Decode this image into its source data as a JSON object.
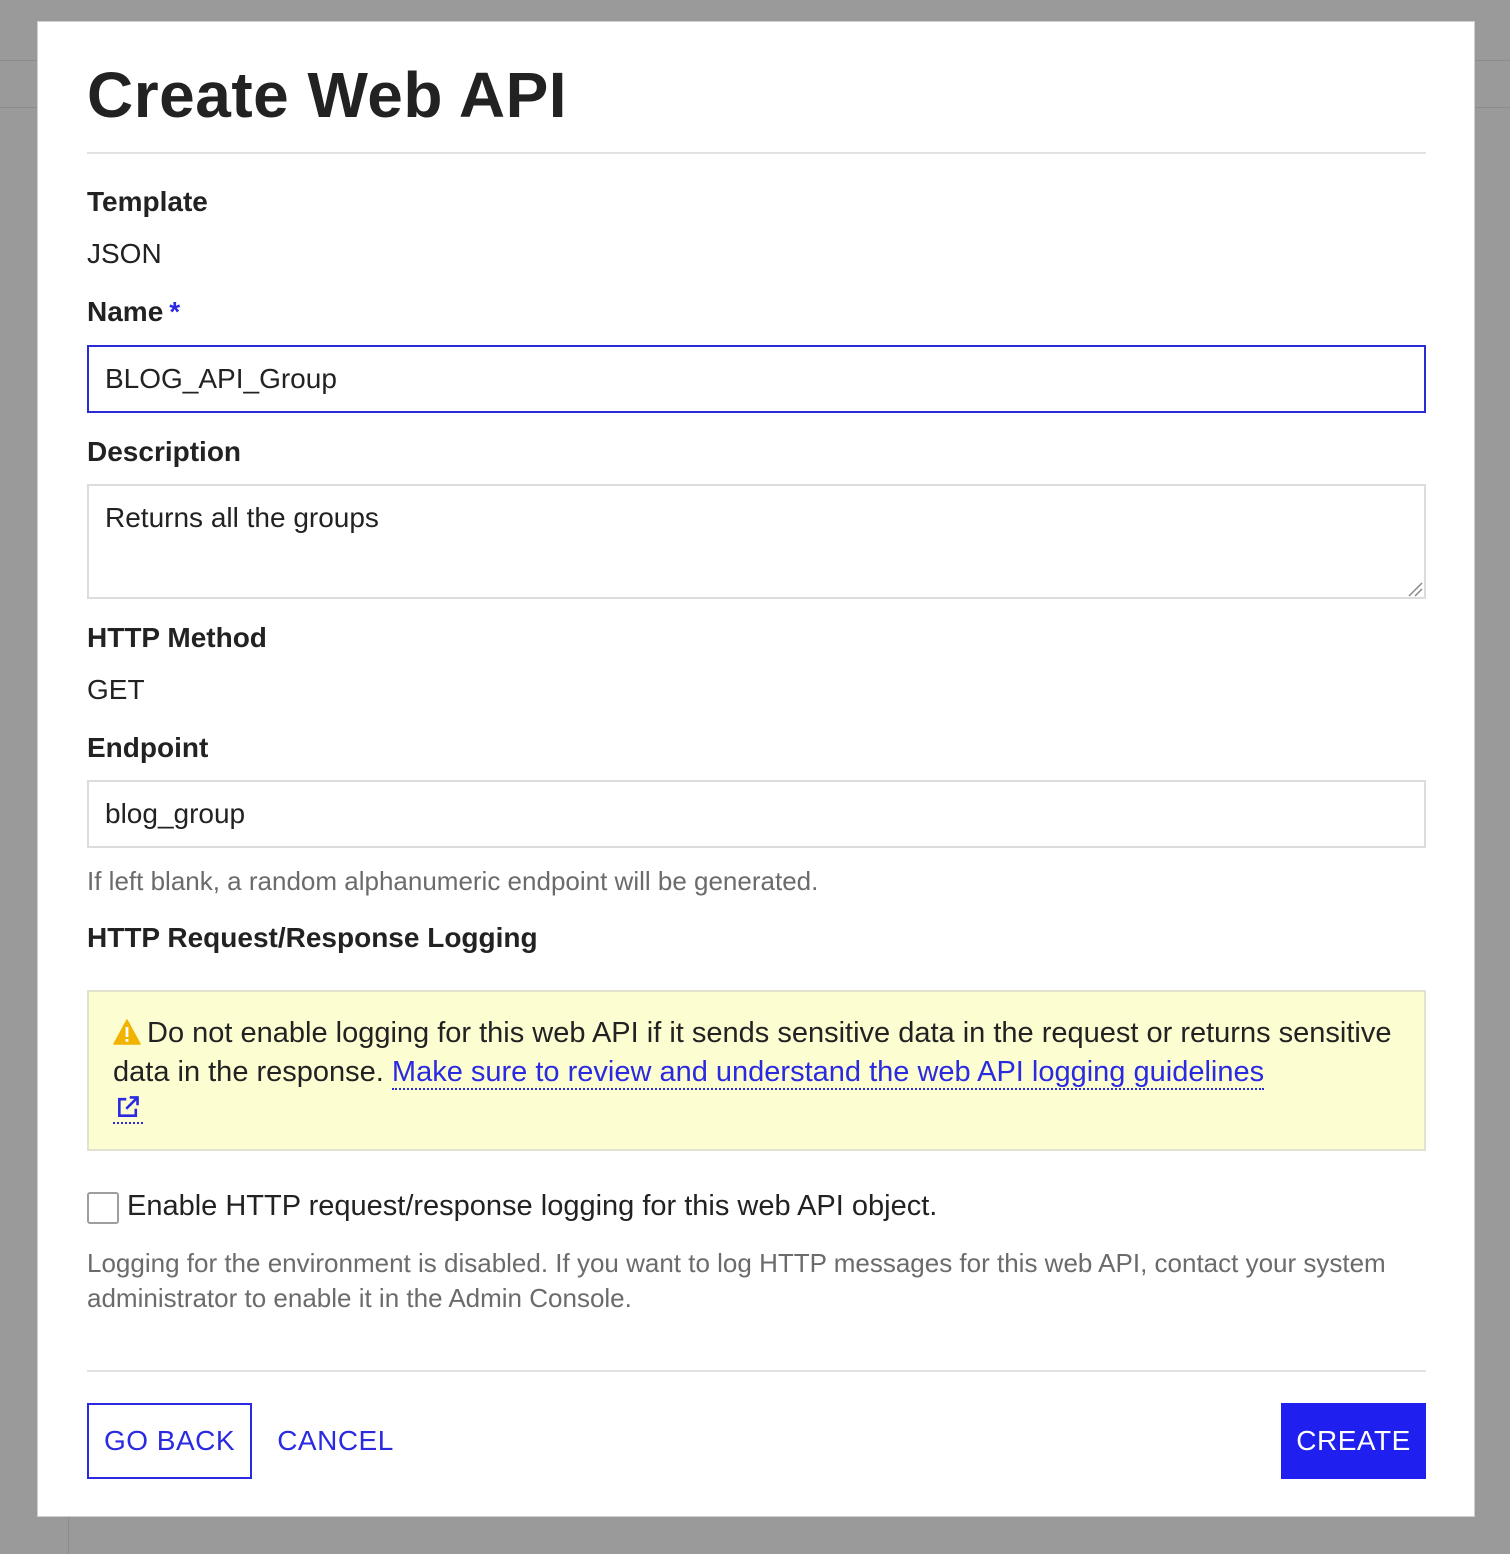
{
  "dialog": {
    "title": "Create Web API"
  },
  "template": {
    "label": "Template",
    "value": "JSON"
  },
  "name": {
    "label": "Name",
    "required_marker": "*",
    "value": "BLOG_API_Group"
  },
  "description": {
    "label": "Description",
    "value": "Returns all the groups"
  },
  "http_method": {
    "label": "HTTP Method",
    "value": "GET"
  },
  "endpoint": {
    "label": "Endpoint",
    "value": "blog_group",
    "hint": "If left blank, a random alphanumeric endpoint will be generated."
  },
  "logging": {
    "label": "HTTP Request/Response Logging",
    "warning_text": "Do not enable logging for this web API if it sends sensitive data in the request or returns sensitive data in the response.",
    "warning_link": "Make sure to review and understand the web API logging guidelines",
    "warning_icon": "warning-triangle-icon",
    "link_icon": "external-link-icon",
    "checkbox_label": "Enable HTTP request/response logging for this web API object.",
    "checkbox_checked": false,
    "disabled_note": "Logging for the environment is disabled. If you want to log HTTP messages for this web API, contact your system administrator to enable it in the Admin Console."
  },
  "buttons": {
    "go_back": "GO BACK",
    "cancel": "CANCEL",
    "create": "CREATE"
  },
  "colors": {
    "accent": "#2a2ae0",
    "primary_button": "#1f1ff0",
    "warning_bg": "#fdfdd2",
    "warning_icon": "#f0b400"
  }
}
